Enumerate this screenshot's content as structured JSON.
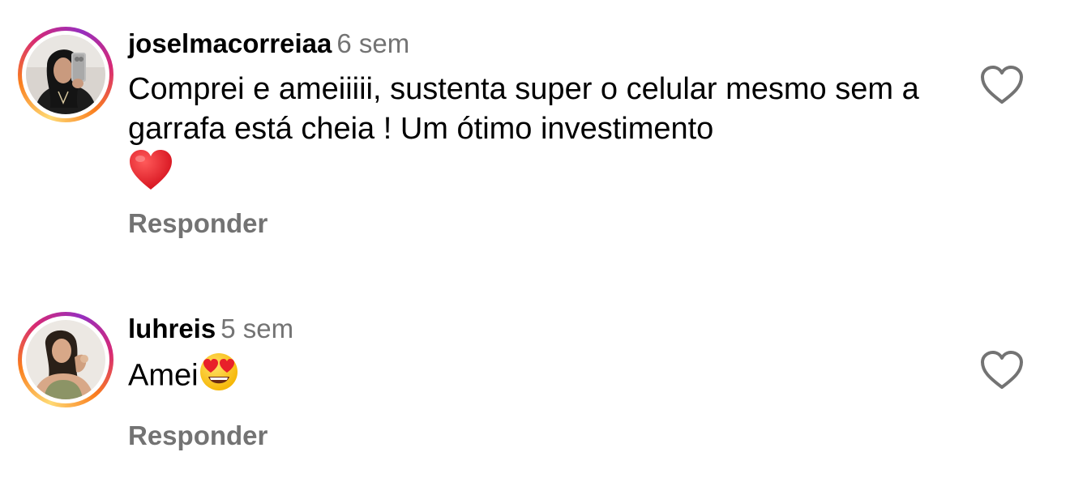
{
  "comments": [
    {
      "username": "joselmacorreiaa",
      "time": "6 sem",
      "text": "Comprei e ameiiiii, sustenta super o celular mesmo sem a garrafa está cheia ! Um ótimo investimento",
      "emoji": "red-heart",
      "reply_label": "Responder",
      "like_icon": "heart-outline-icon"
    },
    {
      "username": "luhreis",
      "time": "5 sem",
      "text": "Amei",
      "emoji": "heart-eyes-face",
      "reply_label": "Responder",
      "like_icon": "heart-outline-icon"
    }
  ],
  "colors": {
    "text": "#000000",
    "muted": "#737373",
    "story_ring": [
      "#feda75",
      "#fa7e1e",
      "#d62976",
      "#962fbf"
    ],
    "heart": "#e8202a",
    "icon_outline": "#737373"
  }
}
